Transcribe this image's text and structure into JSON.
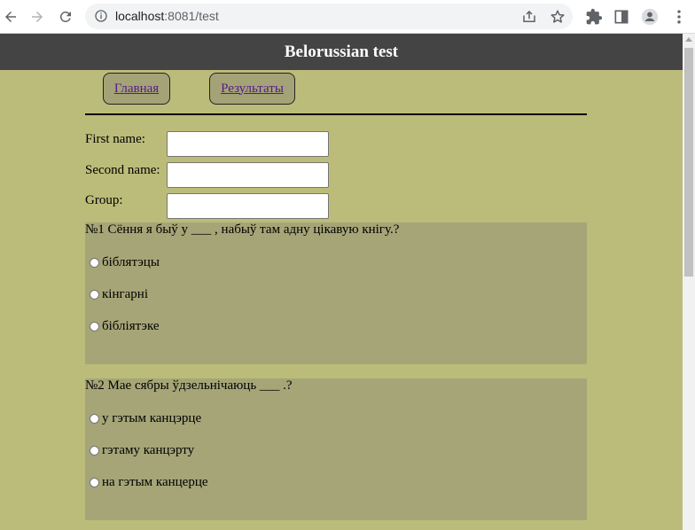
{
  "browser": {
    "url_host": "localhost",
    "url_rest": ":8081/test"
  },
  "page": {
    "title": "Belorussian test"
  },
  "nav": {
    "home_label": "Главная",
    "results_label": "Результаты"
  },
  "form": {
    "first_name_label": "First name:",
    "first_name_value": "",
    "second_name_label": "Second name:",
    "second_name_value": "",
    "group_label": "Group:",
    "group_value": ""
  },
  "questions": [
    {
      "title": "№1 Сёння я быў у ___ , набыў там адну цікавую кнігу.?",
      "options": [
        "бiблятэцы",
        "кінгарні",
        "бібліятэке"
      ]
    },
    {
      "title": "№2 Мае сябры ўдзельнічаюць ___ .?",
      "options": [
        "у гэтым канцэрце",
        "гэтаму канцэрту",
        "на гэтым канцерце"
      ]
    }
  ]
}
